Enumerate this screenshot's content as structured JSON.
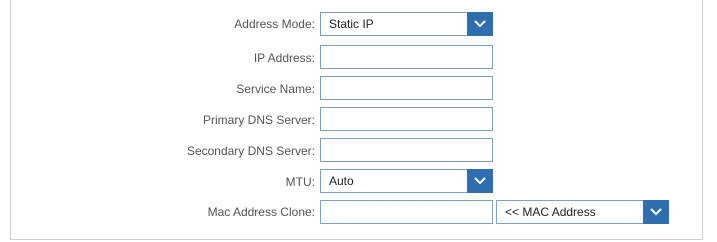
{
  "form": {
    "address_mode": {
      "label": "Address Mode:",
      "value": "Static IP"
    },
    "ip_address": {
      "label": "IP Address:",
      "value": ""
    },
    "service_name": {
      "label": "Service Name:",
      "value": ""
    },
    "primary_dns": {
      "label": "Primary DNS Server:",
      "value": ""
    },
    "secondary_dns": {
      "label": "Secondary DNS Server:",
      "value": ""
    },
    "mtu": {
      "label": "MTU:",
      "value": "Auto"
    },
    "mac_clone": {
      "label": "Mac Address Clone:",
      "value": "",
      "select_value": "<< MAC Address"
    }
  },
  "icons": {
    "dropdown": "chevron-down-icon"
  },
  "colors": {
    "accent": "#2f6fb0",
    "border": "#7ea1c4",
    "label": "#555555"
  }
}
